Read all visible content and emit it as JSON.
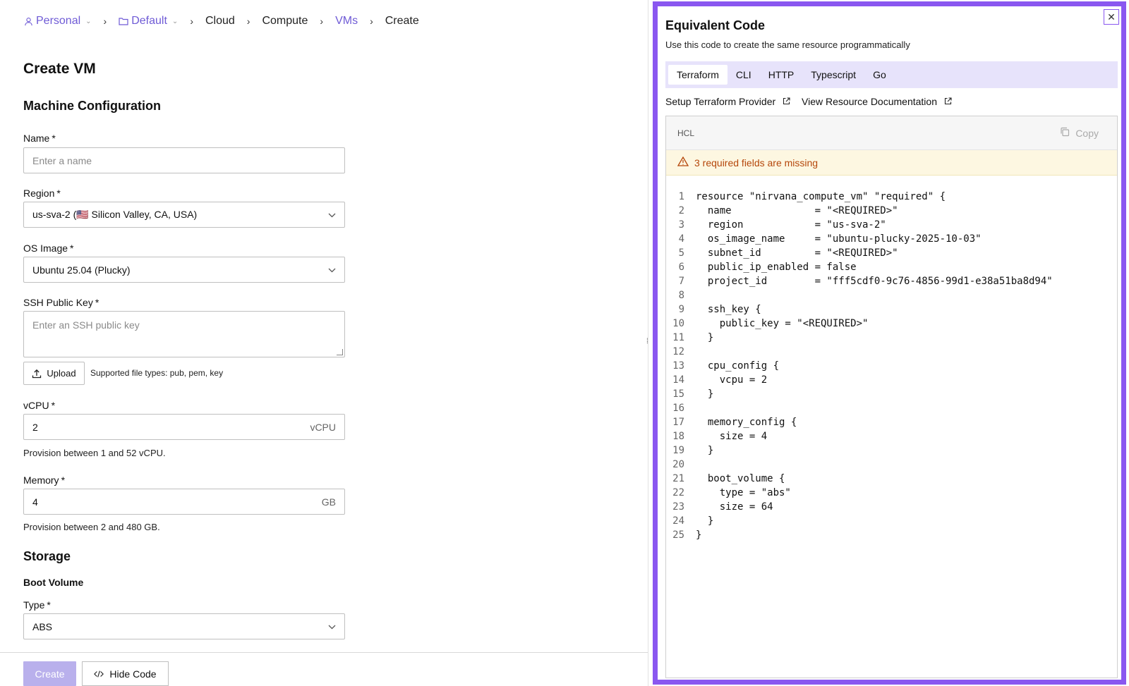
{
  "breadcrumb": {
    "personal": "Personal",
    "default": "Default",
    "cloud": "Cloud",
    "compute": "Compute",
    "vms": "VMs",
    "create": "Create",
    "separator": "›"
  },
  "page": {
    "title": "Create VM",
    "machine_config_heading": "Machine Configuration",
    "storage_heading": "Storage",
    "boot_volume_heading": "Boot Volume"
  },
  "fields": {
    "name_label": "Name",
    "name_placeholder": "Enter a name",
    "region_label": "Region",
    "region_value": "us-sva-2 (🇺🇸 Silicon Valley, CA, USA)",
    "os_label": "OS Image",
    "os_value": "Ubuntu 25.04 (Plucky)",
    "ssh_label": "SSH Public Key",
    "ssh_placeholder": "Enter an SSH public key",
    "upload_label": "Upload",
    "upload_hint": "Supported file types: pub, pem, key",
    "vcpu_label": "vCPU",
    "vcpu_value": "2",
    "vcpu_suffix": "vCPU",
    "vcpu_help": "Provision between 1 and 52 vCPU.",
    "memory_label": "Memory",
    "memory_value": "4",
    "memory_suffix": "GB",
    "memory_help": "Provision between 2 and 480 GB.",
    "type_label": "Type",
    "type_value": "ABS",
    "required_mark": "*"
  },
  "footer": {
    "create_label": "Create",
    "hide_code_label": "Hide Code"
  },
  "code_panel": {
    "title": "Equivalent Code",
    "subtitle": "Use this code to create the same resource programmatically",
    "tabs": [
      {
        "label": "Terraform",
        "active": true
      },
      {
        "label": "CLI",
        "active": false
      },
      {
        "label": "HTTP",
        "active": false
      },
      {
        "label": "Typescript",
        "active": false
      },
      {
        "label": "Go",
        "active": false
      }
    ],
    "setup_link": "Setup Terraform Provider",
    "docs_link": "View Resource Documentation",
    "lang": "HCL",
    "copy_label": "Copy",
    "warning": "3 required fields are missing",
    "lines": [
      "resource \"nirvana_compute_vm\" \"required\" {",
      "  name              = \"<REQUIRED>\"",
      "  region            = \"us-sva-2\"",
      "  os_image_name     = \"ubuntu-plucky-2025-10-03\"",
      "  subnet_id         = \"<REQUIRED>\"",
      "  public_ip_enabled = false",
      "  project_id        = \"fff5cdf0-9c76-4856-99d1-e38a51ba8d94\"",
      "",
      "  ssh_key {",
      "    public_key = \"<REQUIRED>\"",
      "  }",
      "",
      "  cpu_config {",
      "    vcpu = 2",
      "  }",
      "",
      "  memory_config {",
      "    size = 4",
      "  }",
      "",
      "  boot_volume {",
      "    type = \"abs\"",
      "    size = 64",
      "  }",
      "}"
    ]
  },
  "colors": {
    "accent": "#6f5bd6",
    "panel_border": "#8a57f0",
    "tab_bg": "#e7e3fb",
    "warning_text": "#b5470b",
    "warning_bg": "#fdf7e1",
    "create_disabled": "#b9b0ec"
  }
}
